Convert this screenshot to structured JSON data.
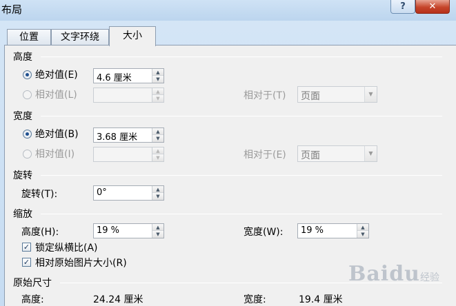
{
  "window": {
    "title": "布局",
    "help": "?",
    "close": "✕"
  },
  "tabs": [
    {
      "label": "位置",
      "active": false
    },
    {
      "label": "文字环绕",
      "active": false
    },
    {
      "label": "大小",
      "active": true
    }
  ],
  "height_section": {
    "title": "高度",
    "absolute": {
      "label": "绝对值(E)",
      "value": "4.6 厘米",
      "selected": true
    },
    "relative": {
      "label": "相对值(L)",
      "value": "",
      "selected": false
    },
    "relative_to": {
      "label": "相对于(T)",
      "value": "页面"
    }
  },
  "width_section": {
    "title": "宽度",
    "absolute": {
      "label": "绝对值(B)",
      "value": "3.68 厘米",
      "selected": true
    },
    "relative": {
      "label": "相对值(I)",
      "value": "",
      "selected": false
    },
    "relative_to": {
      "label": "相对于(E)",
      "value": "页面"
    }
  },
  "rotation": {
    "title": "旋转",
    "label": "旋转(T):",
    "value": "0°"
  },
  "scale": {
    "title": "缩放",
    "height_label": "高度(H):",
    "height_value": "19 %",
    "width_label": "宽度(W):",
    "width_value": "19 %",
    "lock_aspect": {
      "label": "锁定纵横比(A)",
      "checked": true
    },
    "relative_original": {
      "label": "相对原始图片大小(R)",
      "checked": true
    }
  },
  "original_size": {
    "title": "原始尺寸",
    "height_label": "高度:",
    "height_value": "24.24 厘米",
    "width_label": "宽度:",
    "width_value": "19.4 厘米"
  },
  "watermark": {
    "text": "Baidu",
    "suffix": "经验"
  },
  "icons": {
    "spin_up": "spin-up-icon",
    "spin_down": "spin-down-icon",
    "dropdown": "chevron-down-icon",
    "check": "checkmark-icon"
  }
}
